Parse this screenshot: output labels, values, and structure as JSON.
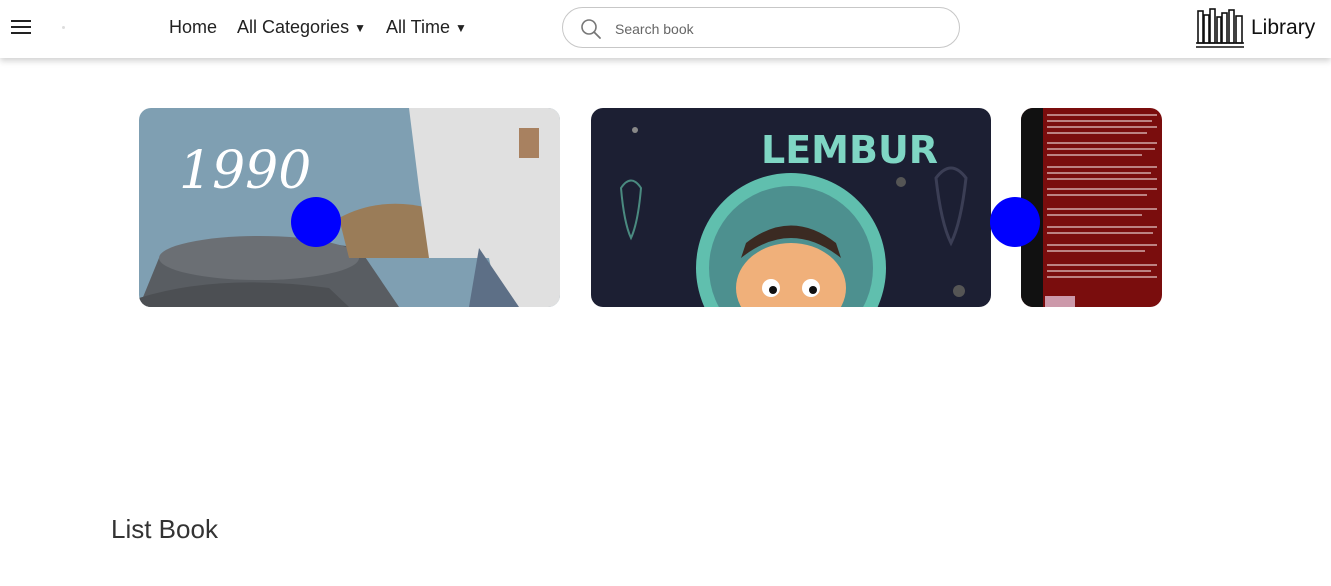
{
  "nav": {
    "links": [
      {
        "label": "Home"
      },
      {
        "label": "All Categories",
        "caret": "▼"
      },
      {
        "label": "All Time",
        "caret": "▼"
      }
    ]
  },
  "search": {
    "placeholder": "Search book",
    "value": ""
  },
  "brand": {
    "name": "Library",
    "icon": "bookshelf-icon"
  },
  "carousel": {
    "cards": [
      {
        "cover_text": "1990"
      },
      {
        "cover_text": "LEMBUR"
      },
      {
        "cover_text": ""
      }
    ],
    "prev_icon": "prev-dot",
    "next_icon": "next-dot",
    "button_color": "#0000ff"
  },
  "section": {
    "title": "List Book"
  }
}
